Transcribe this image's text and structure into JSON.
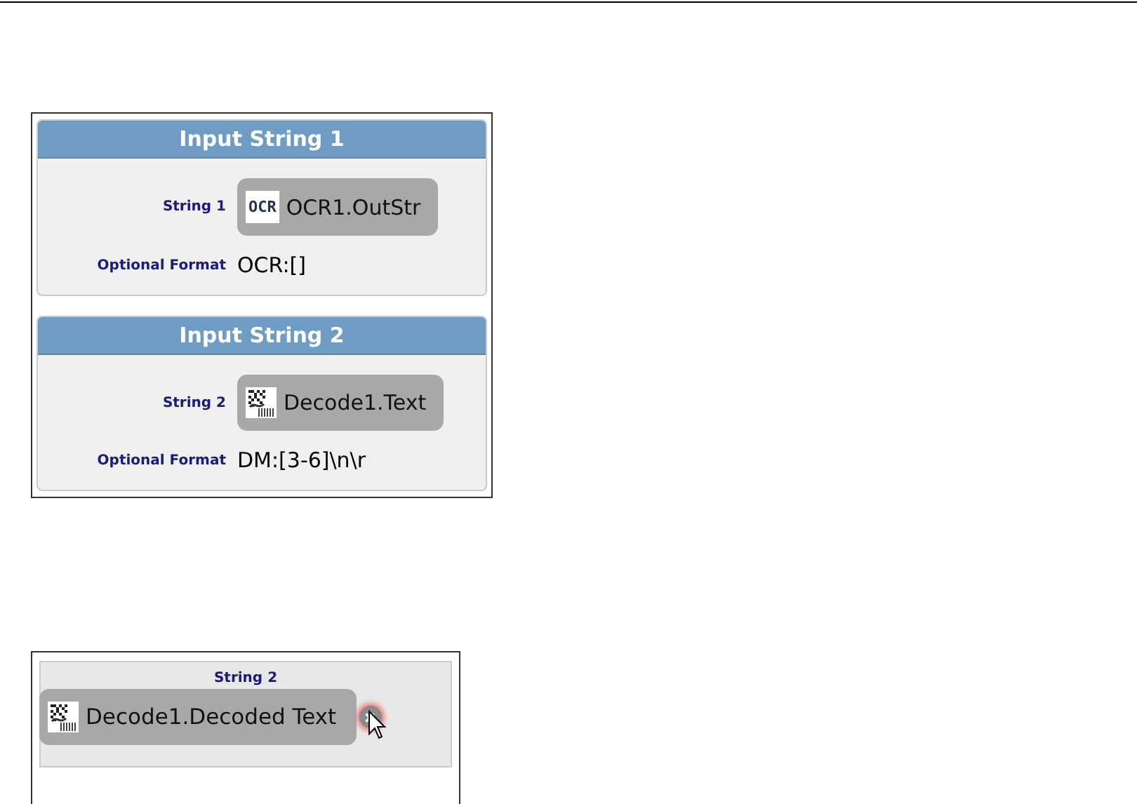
{
  "sections": [
    {
      "title": "Input String 1",
      "source_label": "String 1",
      "source": {
        "kind": "ocr",
        "badge": "OCR",
        "value": "OCR1.OutStr"
      },
      "format_label": "Optional Format",
      "format": "OCR:[]"
    },
    {
      "title": "Input String 2",
      "source_label": "String 2",
      "source": {
        "kind": "code",
        "value": "Decode1.Text"
      },
      "format_label": "Optional Format",
      "format": "DM:[3-6]\\n\\r"
    }
  ],
  "detail": {
    "label": "String 2",
    "source": {
      "kind": "code",
      "value": "Decode1.Decoded Text"
    },
    "remove_hovered": true
  }
}
